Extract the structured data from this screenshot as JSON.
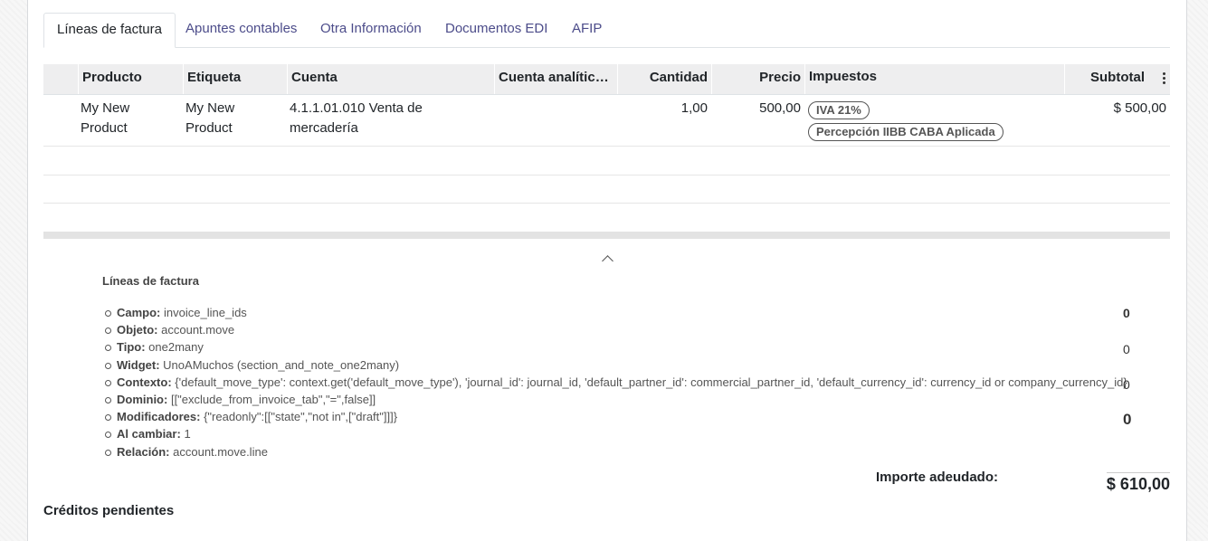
{
  "tabs": [
    {
      "label": "Líneas de factura",
      "active": true
    },
    {
      "label": "Apuntes contables"
    },
    {
      "label": "Otra Información"
    },
    {
      "label": "Documentos EDI"
    },
    {
      "label": "AFIP"
    }
  ],
  "table": {
    "headers": [
      "Producto",
      "Etiqueta",
      "Cuenta",
      "Cuenta analítica…",
      "Cantidad",
      "Precio",
      "Impuestos",
      "Subtotal"
    ],
    "rows": [
      {
        "producto": "My New Product",
        "etiqueta": "My New Product",
        "cuenta": "4.1.1.01.010 Venta de mercadería",
        "cuenta_analitica": "",
        "cantidad": "1,00",
        "precio": "500,00",
        "impuestos": [
          "IVA 21%",
          "Percepción IIBB CABA Aplicada"
        ],
        "subtotal": "$ 500,00"
      }
    ]
  },
  "debug": {
    "title": "Líneas de factura",
    "items": [
      {
        "key": "Campo:",
        "value": "invoice_line_ids"
      },
      {
        "key": "Objeto:",
        "value": "account.move"
      },
      {
        "key": "Tipo:",
        "value": "one2many"
      },
      {
        "key": "Widget:",
        "value": "UnoAMuchos (section_and_note_one2many)"
      },
      {
        "key": "Contexto:",
        "value": "{'default_move_type': context.get('default_move_type'), 'journal_id': journal_id, 'default_partner_id': commercial_partner_id, 'default_currency_id': currency_id or company_currency_id}"
      },
      {
        "key": "Dominio:",
        "value": "[[\"exclude_from_invoice_tab\",\"=\",false]]"
      },
      {
        "key": "Modificadores:",
        "value": "{\"readonly\":[[\"state\",\"not in\",[\"draft\"]]]}"
      },
      {
        "key": "Al cambiar:",
        "value": "1"
      },
      {
        "key": "Relación:",
        "value": "account.move.line"
      }
    ],
    "zeros": [
      "0",
      "0",
      "0",
      "0"
    ]
  },
  "totals": {
    "label": "Importe adeudado:",
    "value": "$ 610,00"
  },
  "credits": {
    "label": "Créditos pendientes"
  }
}
